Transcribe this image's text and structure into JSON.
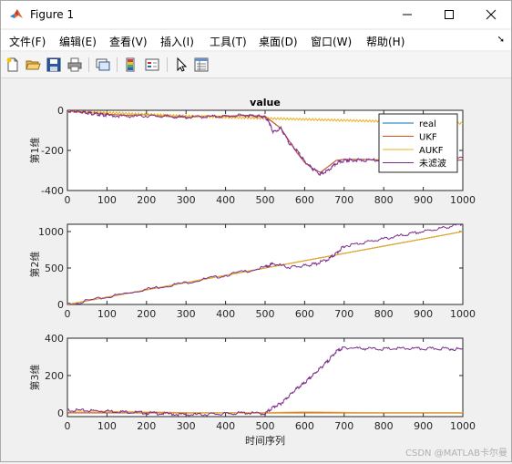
{
  "window": {
    "title": "Figure 1",
    "controls": [
      "minimize",
      "maximize",
      "close"
    ]
  },
  "menu": [
    "文件(F)",
    "编辑(E)",
    "查看(V)",
    "插入(I)",
    "工具(T)",
    "桌面(D)",
    "窗口(W)",
    "帮助(H)"
  ],
  "toolbar": [
    "new-figure-icon",
    "open-file-icon",
    "save-icon",
    "print-icon",
    "copy-figure-icon",
    "colorbar-icon",
    "legend-icon",
    "pointer-icon",
    "property-inspector-icon"
  ],
  "colors": {
    "real": "#0072bd",
    "ukf": "#d95319",
    "aukf": "#edb120",
    "unfiltered": "#7e2f8e"
  },
  "chart_data": [
    {
      "type": "line",
      "title": "value",
      "ylabel": "第1维",
      "xlabel": "",
      "xlim": [
        0,
        1000
      ],
      "ylim": [
        -400,
        0
      ],
      "xticks": [
        "0",
        "100",
        "200",
        "300",
        "400",
        "500",
        "600",
        "700",
        "800",
        "900",
        "1000"
      ],
      "yticks": [
        "0",
        "-200",
        "-400"
      ],
      "legend": {
        "position": "top-right",
        "entries": [
          "real",
          "UKF",
          "AUKF",
          "未滤波"
        ]
      },
      "series": [
        {
          "name": "real",
          "x": [
            0,
            50,
            100,
            150,
            200,
            250,
            300,
            350,
            400,
            450,
            500,
            520,
            540,
            560,
            580,
            600,
            620,
            640,
            660,
            680,
            700,
            750,
            800,
            850,
            900,
            950,
            1000
          ],
          "y": [
            -5,
            -10,
            -20,
            -25,
            -22,
            -30,
            -35,
            -28,
            -30,
            -25,
            -30,
            -60,
            -90,
            -150,
            -210,
            -260,
            -290,
            -310,
            -280,
            -250,
            -245,
            -245,
            -248,
            -250,
            -250,
            -248,
            -248
          ]
        },
        {
          "name": "UKF",
          "x": [
            0,
            50,
            100,
            150,
            200,
            250,
            300,
            350,
            400,
            450,
            500,
            520,
            540,
            560,
            580,
            600,
            620,
            640,
            660,
            680,
            700,
            750,
            800,
            850,
            900,
            950,
            1000
          ],
          "y": [
            -5,
            -10,
            -20,
            -25,
            -22,
            -30,
            -35,
            -28,
            -30,
            -25,
            -30,
            -60,
            -90,
            -150,
            -210,
            -260,
            -290,
            -310,
            -280,
            -250,
            -245,
            -245,
            -248,
            -250,
            -250,
            -248,
            -248
          ]
        },
        {
          "name": "AUKF",
          "x": [
            0,
            100,
            200,
            300,
            400,
            500,
            600,
            700,
            800,
            900,
            1000
          ],
          "y": [
            -5,
            -12,
            -20,
            -28,
            -35,
            -40,
            -45,
            -50,
            -55,
            -60,
            -65
          ]
        },
        {
          "name": "未滤波",
          "x": [
            0,
            20,
            40,
            60,
            80,
            100,
            150,
            200,
            250,
            300,
            350,
            400,
            450,
            480,
            500,
            510,
            520,
            540,
            560,
            580,
            600,
            620,
            640,
            660,
            680,
            700,
            720,
            750,
            800,
            850,
            900,
            950,
            1000
          ],
          "y": [
            -2,
            -5,
            -8,
            -15,
            -20,
            -25,
            -30,
            -28,
            -30,
            -35,
            -32,
            -30,
            -25,
            -28,
            -35,
            -60,
            -110,
            -90,
            -160,
            -200,
            -255,
            -290,
            -320,
            -300,
            -265,
            -250,
            -248,
            -250,
            -248,
            -252,
            -250,
            -246,
            -240
          ]
        }
      ]
    },
    {
      "type": "line",
      "ylabel": "第2维",
      "xlabel": "",
      "xlim": [
        0,
        1000
      ],
      "ylim": [
        0,
        1100
      ],
      "xticks": [
        "0",
        "100",
        "200",
        "300",
        "400",
        "500",
        "600",
        "700",
        "800",
        "900",
        "1000"
      ],
      "yticks": [
        "0",
        "500",
        "1000"
      ],
      "series": [
        {
          "name": "real",
          "x": [
            0,
            100,
            200,
            300,
            400,
            500,
            600,
            700,
            800,
            900,
            1000
          ],
          "y": [
            0,
            100,
            200,
            300,
            400,
            500,
            600,
            700,
            800,
            900,
            1000
          ]
        },
        {
          "name": "UKF",
          "x": [
            0,
            100,
            200,
            300,
            400,
            500,
            600,
            700,
            800,
            900,
            1000
          ],
          "y": [
            0,
            100,
            200,
            300,
            400,
            500,
            600,
            700,
            800,
            900,
            1000
          ]
        },
        {
          "name": "AUKF",
          "x": [
            0,
            100,
            200,
            300,
            400,
            500,
            600,
            700,
            800,
            900,
            1000
          ],
          "y": [
            0,
            100,
            200,
            300,
            400,
            500,
            600,
            700,
            800,
            900,
            1000
          ]
        },
        {
          "name": "未滤波",
          "x": [
            0,
            100,
            200,
            300,
            400,
            500,
            520,
            560,
            600,
            630,
            660,
            680,
            700,
            750,
            800,
            850,
            900,
            950,
            1000
          ],
          "y": [
            0,
            100,
            210,
            300,
            400,
            510,
            560,
            510,
            530,
            560,
            620,
            700,
            800,
            850,
            900,
            950,
            1000,
            1050,
            1100
          ]
        }
      ]
    },
    {
      "type": "line",
      "ylabel": "第3维",
      "xlabel": "时间序列",
      "xlim": [
        0,
        1000
      ],
      "ylim": [
        -20,
        400
      ],
      "xticks": [
        "0",
        "100",
        "200",
        "300",
        "400",
        "500",
        "600",
        "700",
        "800",
        "900",
        "1000"
      ],
      "yticks": [
        "0",
        "200",
        "400"
      ],
      "series": [
        {
          "name": "real",
          "x": [
            0,
            1000
          ],
          "y": [
            0,
            0
          ]
        },
        {
          "name": "UKF",
          "x": [
            0,
            1000
          ],
          "y": [
            0,
            0
          ]
        },
        {
          "name": "AUKF",
          "x": [
            0,
            100,
            200,
            300,
            400,
            500,
            600,
            700,
            800,
            900,
            1000
          ],
          "y": [
            10,
            8,
            5,
            2,
            0,
            2,
            5,
            3,
            2,
            2,
            2
          ]
        },
        {
          "name": "未滤波",
          "x": [
            0,
            50,
            100,
            150,
            200,
            250,
            300,
            350,
            400,
            450,
            500,
            520,
            540,
            560,
            580,
            600,
            620,
            640,
            660,
            680,
            700,
            750,
            800,
            850,
            900,
            950,
            1000
          ],
          "y": [
            15,
            12,
            10,
            5,
            0,
            -5,
            -10,
            -8,
            -5,
            0,
            -5,
            30,
            50,
            90,
            130,
            160,
            200,
            240,
            280,
            330,
            350,
            345,
            342,
            345,
            343,
            345,
            340
          ]
        }
      ]
    }
  ],
  "watermark": "CSDN @MATLAB卡尔曼"
}
